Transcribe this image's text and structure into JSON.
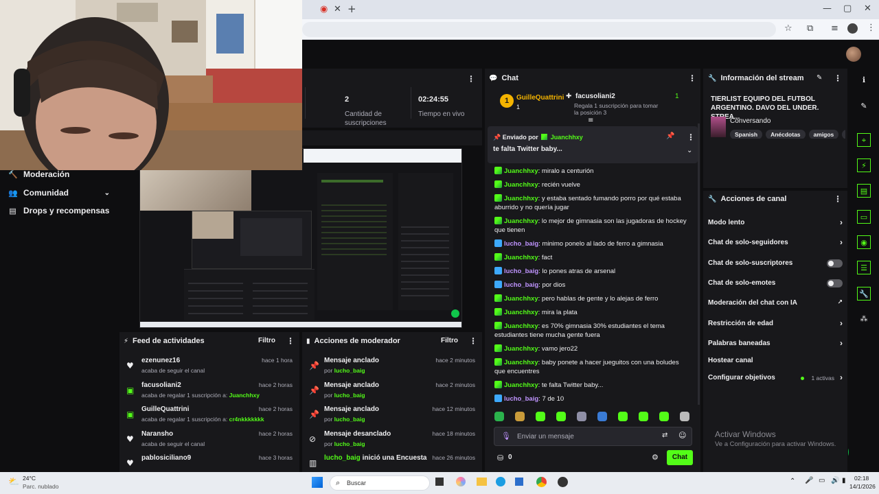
{
  "browser": {
    "new_tab": "+",
    "address_icons": [
      "star-icon",
      "extensions-icon",
      "media-icon",
      "profile-icon",
      "menu-icon"
    ],
    "window_controls": [
      "—",
      "▢",
      "✕"
    ]
  },
  "nav": {
    "items": [
      {
        "label": "Moderación"
      },
      {
        "label": "Comunidad"
      },
      {
        "label": "Drops y recompensas"
      }
    ]
  },
  "stats": [
    {
      "value": "2",
      "label": "Cantidad de suscripciones"
    },
    {
      "value": "02:24:55",
      "label": "Tiempo en vivo"
    }
  ],
  "chat": {
    "title": "Chat",
    "top_sub": {
      "user": "GuilleQuattrini",
      "count": "1",
      "rank": "1"
    },
    "gift": {
      "user": "facusoliani2",
      "text": "Regala 1 suscripción para tomar la posición 3",
      "count": "1"
    },
    "pinned": {
      "label": "Enviado por",
      "user": "Juanchhxy",
      "text": "te falta Twitter baby..."
    },
    "messages": [
      {
        "user": "Juanchhxy",
        "text": "miralo a centurión",
        "badge": "green"
      },
      {
        "user": "Juanchhxy",
        "text": "recién vuelve",
        "badge": "green"
      },
      {
        "user": "Juanchhxy",
        "text": "y estaba sentado fumando porro por qué estaba aburrido y no quería jugar",
        "badge": "green"
      },
      {
        "user": "Juanchhxy",
        "text": "lo mejor de gimnasia son las jugadoras de hockey que tienen",
        "badge": "green"
      },
      {
        "user": "lucho_baig",
        "text": "minimo ponelo al lado de ferro a gimnasia",
        "badge": "blue"
      },
      {
        "user": "Juanchhxy",
        "text": "fact",
        "badge": "green"
      },
      {
        "user": "lucho_baig",
        "text": "lo pones atras de arsenal",
        "badge": "blue"
      },
      {
        "user": "lucho_baig",
        "text": "por dios",
        "badge": "blue"
      },
      {
        "user": "Juanchhxy",
        "text": "pero hablas de gente y lo alejas de ferro",
        "badge": "green"
      },
      {
        "user": "Juanchhxy",
        "text": "mira la plata",
        "badge": "green"
      },
      {
        "user": "Juanchhxy",
        "text": "es 70% gimnasia 30% estudiantes el tema estudiantes tiene mucha gente fuera",
        "badge": "green"
      },
      {
        "user": "Juanchhxy",
        "text": "vamo jero22",
        "badge": "green"
      },
      {
        "user": "Juanchhxy",
        "text": "baby ponete a hacer jueguitos con una boludes que encuentres",
        "badge": "green"
      },
      {
        "user": "Juanchhxy",
        "text": "te falta Twitter baby...",
        "badge": "green"
      },
      {
        "user": "lucho_baig",
        "text": "7 de 10",
        "badge": "blue"
      }
    ],
    "input_placeholder": "Enviar un mensaje",
    "points": "0",
    "send_label": "Chat"
  },
  "stream_info": {
    "title": "Información del stream",
    "stream_title": "TIERLIST EQUIPO DEL FUTBOL ARGENTINO. DAVO DEL UNDER. STREA...",
    "category": "Conversando",
    "tags": [
      "Spanish",
      "Anécdotas",
      "amigos",
      "ar"
    ]
  },
  "channel_actions": {
    "title": "Acciones de canal",
    "items": [
      {
        "label": "Modo lento",
        "control": "chevron"
      },
      {
        "label": "Chat de solo-seguidores",
        "control": "chevron"
      },
      {
        "label": "Chat de solo-suscriptores",
        "control": "toggle"
      },
      {
        "label": "Chat de solo-emotes",
        "control": "toggle"
      },
      {
        "label": "Moderación del chat con IA",
        "control": "external"
      },
      {
        "label": "Restricción de edad",
        "control": "chevron"
      },
      {
        "label": "Palabras baneadas",
        "control": "chevron"
      },
      {
        "label": "Hostear canal",
        "control": "none"
      },
      {
        "label": "Configurar objetivos",
        "control": "chevron",
        "status": "1 activas"
      }
    ]
  },
  "activity_feed": {
    "title": "Feed de actividades",
    "filter": "Filtro",
    "items": [
      {
        "icon": "heart-icon",
        "name": "ezenunez16",
        "sub": "acaba de seguir el canal",
        "highlight": "",
        "time": "hace 1 hora"
      },
      {
        "icon": "gift-icon",
        "name": "facusoliani2",
        "sub": "acaba de regalar 1 suscripción a:",
        "highlight": "Juanchhxy",
        "time": "hace 2 horas"
      },
      {
        "icon": "gift-icon",
        "name": "GuilleQuattrini",
        "sub": "acaba de regalar 1 suscripción a:",
        "highlight": "cr4nkkkkkkk",
        "time": "hace 2 horas"
      },
      {
        "icon": "heart-icon",
        "name": "Naransho",
        "sub": "acaba de seguir el canal",
        "highlight": "",
        "time": "hace 2 horas"
      },
      {
        "icon": "heart-icon",
        "name": "pablosiciliano9",
        "sub": "",
        "highlight": "",
        "time": "hace 3 horas"
      }
    ]
  },
  "mod_actions": {
    "title": "Acciones de moderador",
    "filter": "Filtro",
    "items": [
      {
        "icon": "pin-icon",
        "action": "Mensaje anclado",
        "by": "por",
        "user": "lucho_baig",
        "time": "hace 2 minutos"
      },
      {
        "icon": "pin-icon",
        "action": "Mensaje anclado",
        "by": "por",
        "user": "lucho_baig",
        "time": "hace 2 minutos"
      },
      {
        "icon": "pin-icon",
        "action": "Mensaje anclado",
        "by": "por",
        "user": "lucho_baig",
        "time": "hace 12 minutos"
      },
      {
        "icon": "unpin-icon",
        "action": "Mensaje desanclado",
        "by": "por",
        "user": "lucho_baig",
        "time": "hace 18 minutos"
      },
      {
        "icon": "poll-icon",
        "action": "inició una Encuesta",
        "by": "",
        "user": "lucho_baig",
        "time": "hace 26 minutos"
      }
    ]
  },
  "watermark": {
    "title": "Activar Windows",
    "sub": "Ve a Configuración para activar Windows."
  },
  "taskbar": {
    "weather_temp": "24°C",
    "weather_desc": "Parc. nublado",
    "search": "Buscar",
    "time": "02:18",
    "date": "14/1/2026"
  }
}
